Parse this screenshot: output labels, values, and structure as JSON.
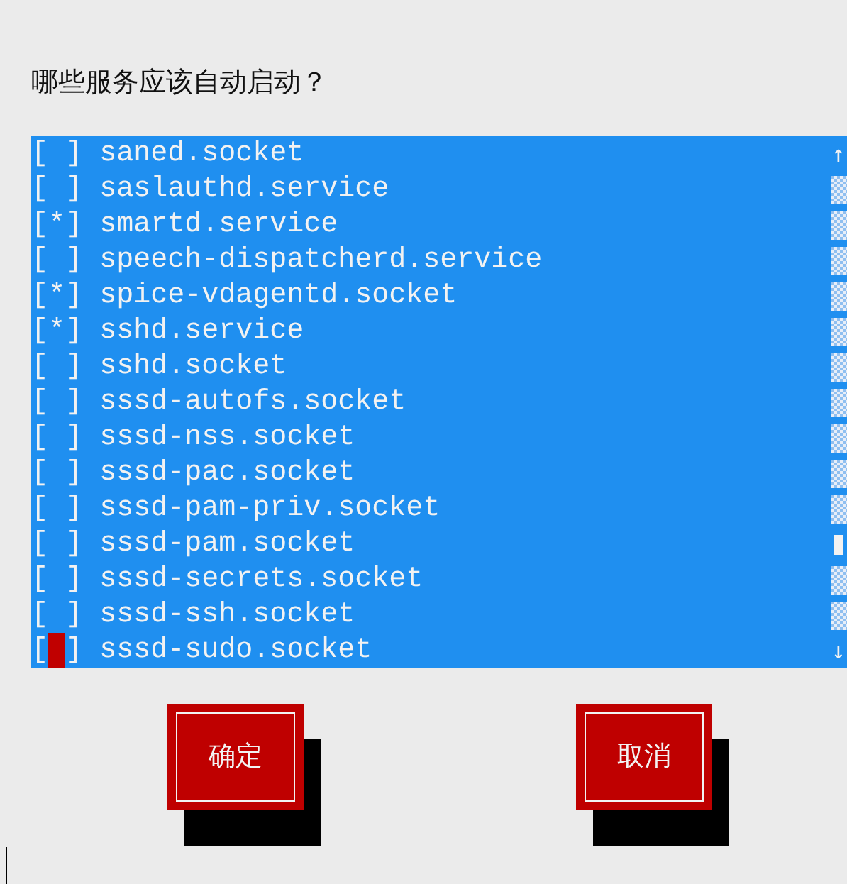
{
  "prompt": "哪些服务应该自动启动？",
  "checkbox": {
    "left": "[",
    "right": "]",
    "mark": "*"
  },
  "items": [
    {
      "label": "saned.socket",
      "checked": false,
      "focused": false
    },
    {
      "label": "saslauthd.service",
      "checked": false,
      "focused": false
    },
    {
      "label": "smartd.service",
      "checked": true,
      "focused": false
    },
    {
      "label": "speech-dispatcherd.service",
      "checked": false,
      "focused": false
    },
    {
      "label": "spice-vdagentd.socket",
      "checked": true,
      "focused": false
    },
    {
      "label": "sshd.service",
      "checked": true,
      "focused": false
    },
    {
      "label": "sshd.socket",
      "checked": false,
      "focused": false
    },
    {
      "label": "sssd-autofs.socket",
      "checked": false,
      "focused": false
    },
    {
      "label": "sssd-nss.socket",
      "checked": false,
      "focused": false
    },
    {
      "label": "sssd-pac.socket",
      "checked": false,
      "focused": false
    },
    {
      "label": "sssd-pam-priv.socket",
      "checked": false,
      "focused": false
    },
    {
      "label": "sssd-pam.socket",
      "checked": false,
      "focused": false
    },
    {
      "label": "sssd-secrets.socket",
      "checked": false,
      "focused": false
    },
    {
      "label": "sssd-ssh.socket",
      "checked": false,
      "focused": false
    },
    {
      "label": "sssd-sudo.socket",
      "checked": false,
      "focused": true
    }
  ],
  "scrollbar": {
    "up": "↑",
    "down": "↓"
  },
  "buttons": [
    "确定",
    "取消"
  ]
}
